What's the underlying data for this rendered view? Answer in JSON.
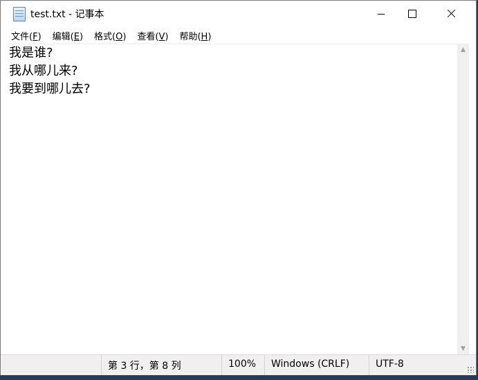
{
  "window": {
    "title": "test.txt - 记事本",
    "icon": "notepad-icon"
  },
  "menu": [
    {
      "label": "文件(",
      "mnemonic": "F",
      "close": ")"
    },
    {
      "label": "编辑(",
      "mnemonic": "E",
      "close": ")"
    },
    {
      "label": "格式(",
      "mnemonic": "O",
      "close": ")"
    },
    {
      "label": "查看(",
      "mnemonic": "V",
      "close": ")"
    },
    {
      "label": "帮助(",
      "mnemonic": "H",
      "close": ")"
    }
  ],
  "editor": {
    "lines": [
      "我是谁?",
      "我从哪儿来?",
      "我要到哪儿去?"
    ]
  },
  "status": {
    "position": "第 3 行，第 8 列",
    "zoom": "100%",
    "line_ending": "Windows (CRLF)",
    "encoding": "UTF-8"
  }
}
